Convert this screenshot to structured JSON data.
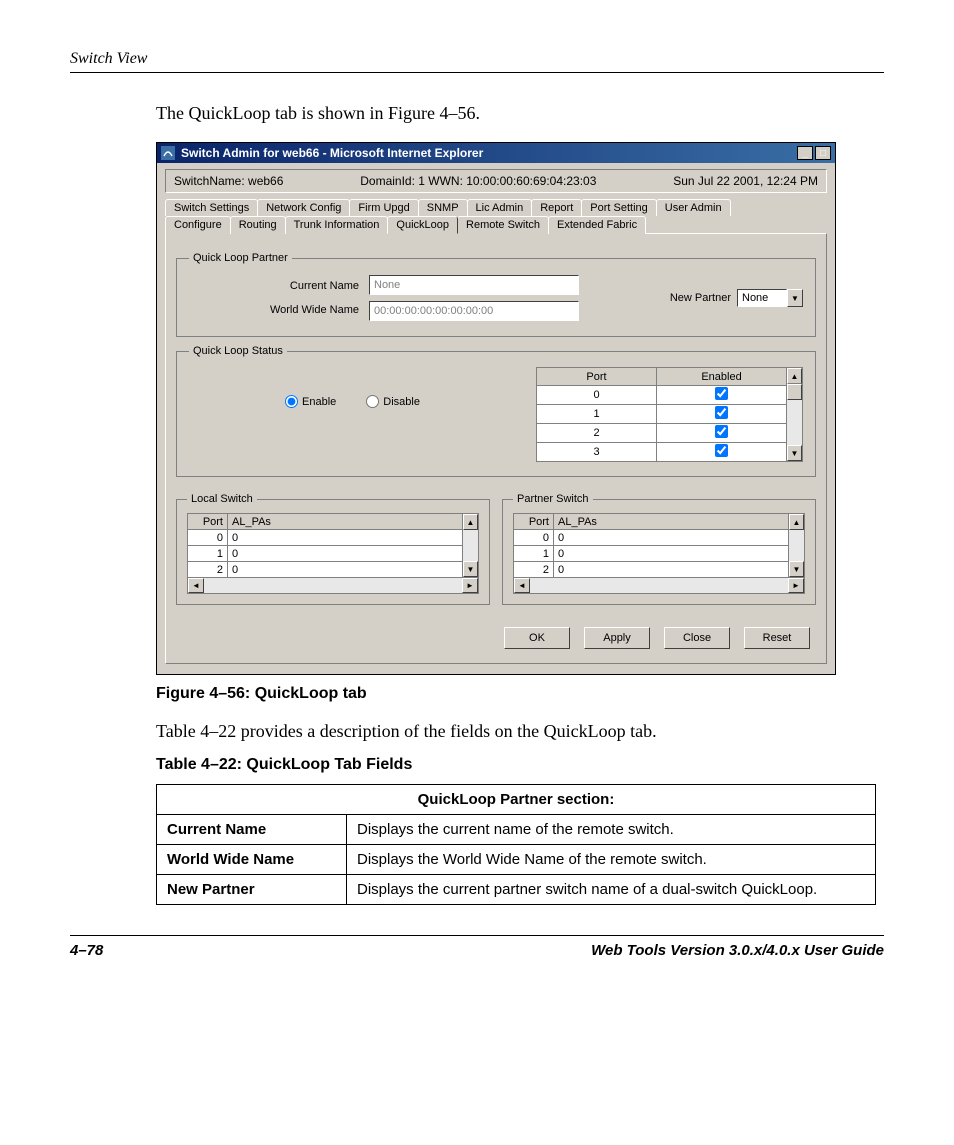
{
  "page": {
    "running_head": "Switch View",
    "intro": "The QuickLoop tab is shown in Figure 4–56.",
    "figure_caption": "Figure 4–56:  QuickLoop tab",
    "table_intro": "Table 4–22 provides a description of the fields on the QuickLoop tab.",
    "table_caption": "Table 4–22:  QuickLoop Tab Fields",
    "footer_left": "4–78",
    "footer_right": "Web Tools Version 3.0.x/4.0.x User Guide"
  },
  "window": {
    "title": "Switch Admin for web66 - Microsoft Internet Explorer",
    "info": {
      "switch_name": "SwitchName: web66",
      "domain": "DomainId: 1  WWN: 10:00:00:60:69:04:23:03",
      "timestamp": "Sun Jul 22  2001, 12:24 PM"
    },
    "tabs_row1": [
      "Switch Settings",
      "Network Config",
      "Firm Upgd",
      "SNMP",
      "Lic Admin",
      "Report",
      "Port Setting",
      "User Admin"
    ],
    "tabs_row2": [
      "Configure",
      "Routing",
      "Trunk Information",
      "QuickLoop",
      "Remote Switch",
      "Extended Fabric"
    ],
    "active_tab": "QuickLoop",
    "qlp": {
      "legend": "Quick Loop Partner",
      "current_name_label": "Current Name",
      "current_name_value": "None",
      "wwn_label": "World Wide Name",
      "wwn_value": "00:00:00:00:00:00:00:00",
      "new_partner_label": "New Partner",
      "new_partner_value": "None"
    },
    "status": {
      "legend": "Quick Loop Status",
      "enable_label": "Enable",
      "disable_label": "Disable",
      "selected": "enable",
      "headers": {
        "port": "Port",
        "enabled": "Enabled"
      },
      "rows": [
        {
          "port": "0",
          "enabled": true
        },
        {
          "port": "1",
          "enabled": true
        },
        {
          "port": "2",
          "enabled": true
        },
        {
          "port": "3",
          "enabled": true
        }
      ]
    },
    "local": {
      "legend": "Local Switch",
      "headers": {
        "port": "Port",
        "alpa": "AL_PAs"
      },
      "rows": [
        {
          "port": "0",
          "alpa": "0"
        },
        {
          "port": "1",
          "alpa": "0"
        },
        {
          "port": "2",
          "alpa": "0"
        }
      ]
    },
    "partner": {
      "legend": "Partner Switch",
      "headers": {
        "port": "Port",
        "alpa": "AL_PAs"
      },
      "rows": [
        {
          "port": "0",
          "alpa": "0"
        },
        {
          "port": "1",
          "alpa": "0"
        },
        {
          "port": "2",
          "alpa": "0"
        }
      ]
    },
    "buttons": {
      "ok": "OK",
      "apply": "Apply",
      "close": "Close",
      "reset": "Reset"
    }
  },
  "doc_table": {
    "section_header": "QuickLoop Partner section:",
    "rows": [
      {
        "k": "Current Name",
        "v": "Displays the current name of the remote switch."
      },
      {
        "k": "World Wide Name",
        "v": "Displays the World Wide Name of the remote switch."
      },
      {
        "k": "New Partner",
        "v": "Displays the current partner switch name of a dual-switch QuickLoop."
      }
    ]
  }
}
